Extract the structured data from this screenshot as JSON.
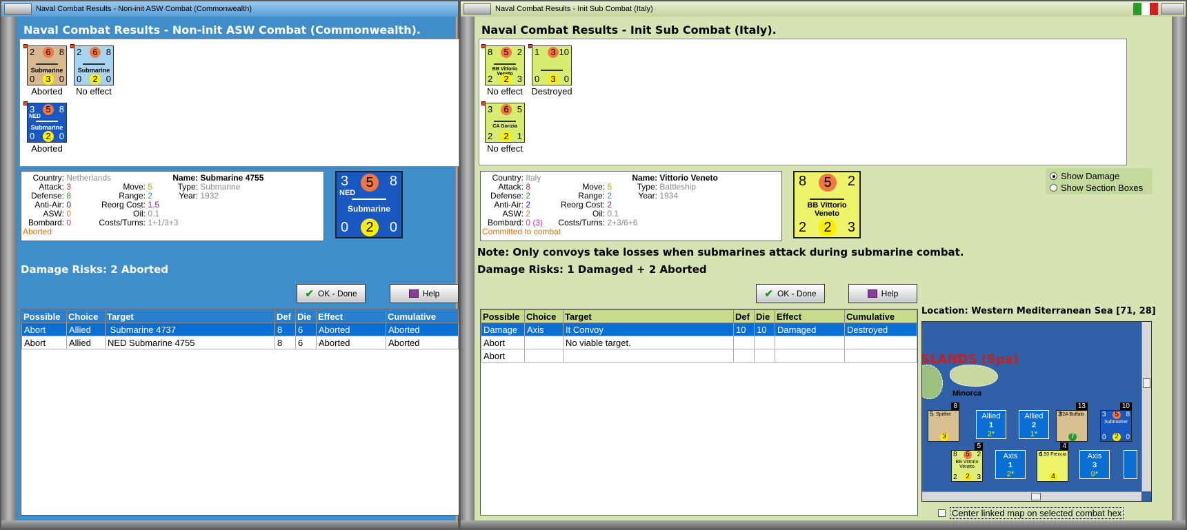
{
  "left": {
    "window_title": "Naval Combat Results - Non-init ASW Combat (Commonwealth)",
    "heading": "Naval Combat Results - Non-init ASW Combat (Commonwealth).",
    "counters": [
      {
        "tl": "2",
        "tc": "6",
        "tr": "8",
        "name": "Submarine",
        "bl": "0",
        "bc": "3",
        "br": "0",
        "label": "Aborted",
        "bg": "#d8b890"
      },
      {
        "tl": "2",
        "tc": "6",
        "tr": "8",
        "name": "Submarine",
        "bl": "0",
        "bc": "2",
        "br": "0",
        "label": "No effect",
        "bg": "#a8d4f0"
      },
      {
        "tl": "3",
        "tc": "5",
        "tr": "8",
        "name": "Submarine",
        "flag": "NED",
        "bl": "0",
        "bc": "2",
        "br": "0",
        "label": "Aborted",
        "bg": "#1858c0"
      }
    ],
    "info": {
      "country_label": "Country:",
      "country": "Netherlands",
      "attack_label": "Attack:",
      "attack": "3",
      "defense_label": "Defense:",
      "defense": "8",
      "antiair_label": "Anti-Air:",
      "antiair": "0",
      "asw_label": "ASW:",
      "asw": "0",
      "bombard_label": "Bombard:",
      "bombard": "0",
      "status": "Aborted",
      "move_label": "Move:",
      "move": "5",
      "range_label": "Range:",
      "range": "2",
      "reorg_label": "Reorg Cost:",
      "reorg": "1.5",
      "oil_label": "Oil:",
      "oil": "0.1",
      "costs_label": "Costs/Turns:",
      "costs": "1+1/3+3",
      "name_label": "Name:",
      "name": "Submarine 4755",
      "type_label": "Type:",
      "type": "Submarine",
      "year_label": "Year:",
      "year": "1932"
    },
    "big_counter": {
      "tl": "3",
      "tc": "5",
      "tr": "8",
      "flag": "NED",
      "name": "Submarine",
      "bl": "0",
      "bc": "2",
      "br": "0"
    },
    "damage_risks": "Damage Risks:  2 Aborted",
    "ok_label": "OK - Done",
    "help_label": "Help",
    "table_headers": [
      "Possible",
      "Choice",
      "Target",
      "Def",
      "Die",
      "Effect",
      "Cumulative"
    ],
    "rows": [
      [
        "Abort",
        "Allied",
        " Submarine 4737",
        "8",
        "6",
        "Aborted",
        "Aborted"
      ],
      [
        "Abort",
        "Allied",
        "NED Submarine 4755",
        "8",
        "6",
        "Aborted",
        "Aborted"
      ]
    ]
  },
  "right": {
    "window_title": "Naval Combat Results - Init Sub Combat (Italy)",
    "heading": "Naval Combat Results - Init Sub Combat (Italy).",
    "counters": [
      {
        "tl": "8",
        "tc": "5",
        "tr": "2",
        "name": "BB Vittorio Veneto",
        "bl": "2",
        "bc": "2",
        "br": "3",
        "label": "No effect",
        "bg": "#d8ec70"
      },
      {
        "tl": "1",
        "tc": "3",
        "tr": "10",
        "name": "",
        "bl": "0",
        "bc": "3",
        "br": "0",
        "label": "Destroyed",
        "bg": "#d8ec70"
      },
      {
        "tl": "3",
        "tc": "6",
        "tr": "5",
        "name": "CA Gorizia",
        "bl": "2",
        "bc": "2",
        "br": "1",
        "label": "No effect",
        "bg": "#d8ec70"
      }
    ],
    "info": {
      "country_label": "Country:",
      "country": "Italy",
      "attack_label": "Attack:",
      "attack": "8",
      "defense_label": "Defense:",
      "defense": "2",
      "antiair_label": "Anti-Air:",
      "antiair": "2",
      "asw_label": "ASW:",
      "asw": "2",
      "bombard_label": "Bombard:",
      "bombard": "0 (3)",
      "status": "Committed to combat",
      "move_label": "Move:",
      "move": "5",
      "range_label": "Range:",
      "range": "2",
      "reorg_label": "Reorg Cost:",
      "reorg": "2",
      "oil_label": "Oil:",
      "oil": "0.1",
      "costs_label": "Costs/Turns:",
      "costs": "2+3/6+6",
      "name_label": "Name:",
      "name": "Vittorio Veneto",
      "type_label": "Type:",
      "type": "Battleship",
      "year_label": "Year:",
      "year": "1934"
    },
    "big_counter": {
      "tl": "8",
      "tc": "5",
      "tr": "2",
      "name": "BB Vittorio Veneto",
      "bl": "2",
      "bc": "2",
      "br": "3"
    },
    "show_damage": "Show Damage",
    "show_section_boxes": "Show Section Boxes",
    "note": "Note: Only convoys take losses when submarines attack during submarine combat.",
    "damage_risks": "Damage Risks:  1 Damaged + 2 Aborted",
    "ok_label": "OK - Done",
    "help_label": "Help",
    "table_headers": [
      "Possible",
      "Choice",
      "Target",
      "Def",
      "Die",
      "Effect",
      "Cumulative"
    ],
    "rows": [
      [
        "Damage",
        "Axis",
        "It Convoy",
        "10",
        "10",
        "Damaged",
        "Destroyed"
      ],
      [
        "Abort",
        "",
        "No viable target.",
        "",
        "",
        "",
        ""
      ],
      [
        "Abort",
        "",
        "",
        "",
        "",
        "",
        ""
      ]
    ],
    "location": "Location:  Western Mediterranean Sea [71, 28]",
    "map": {
      "region": "SLANDS (Spa)",
      "minorca": "Minorca",
      "counters": [
        {
          "stack": "8",
          "tl": "5",
          "name": "Spitfire",
          "bc": "3"
        },
        {
          "stack": "13",
          "tl": "3",
          "tr": "",
          "name": "F2A Buffalo",
          "bc": "7"
        },
        {
          "stack": "10",
          "tl": "3",
          "tc": "5",
          "tr": "8",
          "name": "Submarine",
          "bl": "0",
          "bc": "2",
          "br": "0"
        },
        {
          "stack": "5",
          "tl": "8",
          "tc": "5",
          "tr": "2",
          "name": "BB Vittorio Veneto",
          "bl": "2",
          "bc": "2",
          "br": "3"
        },
        {
          "stack": "4",
          "tl": "4",
          "tr": "",
          "name": "G.50 Freccia",
          "bc": "4"
        }
      ],
      "boxes": [
        {
          "side": "Allied",
          "num": "1",
          "sub": "2*"
        },
        {
          "side": "Allied",
          "num": "2",
          "sub": "1*"
        },
        {
          "side": "Axis",
          "num": "1",
          "sub": "2*"
        },
        {
          "side": "Axis",
          "num": "3",
          "sub": "0*"
        }
      ]
    },
    "center_map_label": "Center linked map on selected combat hex"
  },
  "colors": {
    "left_bg": "#3f8ec9",
    "right_bg": "#d6e4b4",
    "selected_row": "#0a6fd4",
    "attack": "#e02020",
    "defense": "#20a020",
    "antiair": "#2020e0",
    "asw": "#e08000",
    "bombard": "#e020e0",
    "move": "#c0a000",
    "range": "#20a0a0",
    "reorg": "#9020a0",
    "muted": "#8a8a8a",
    "status": "#e07000"
  }
}
